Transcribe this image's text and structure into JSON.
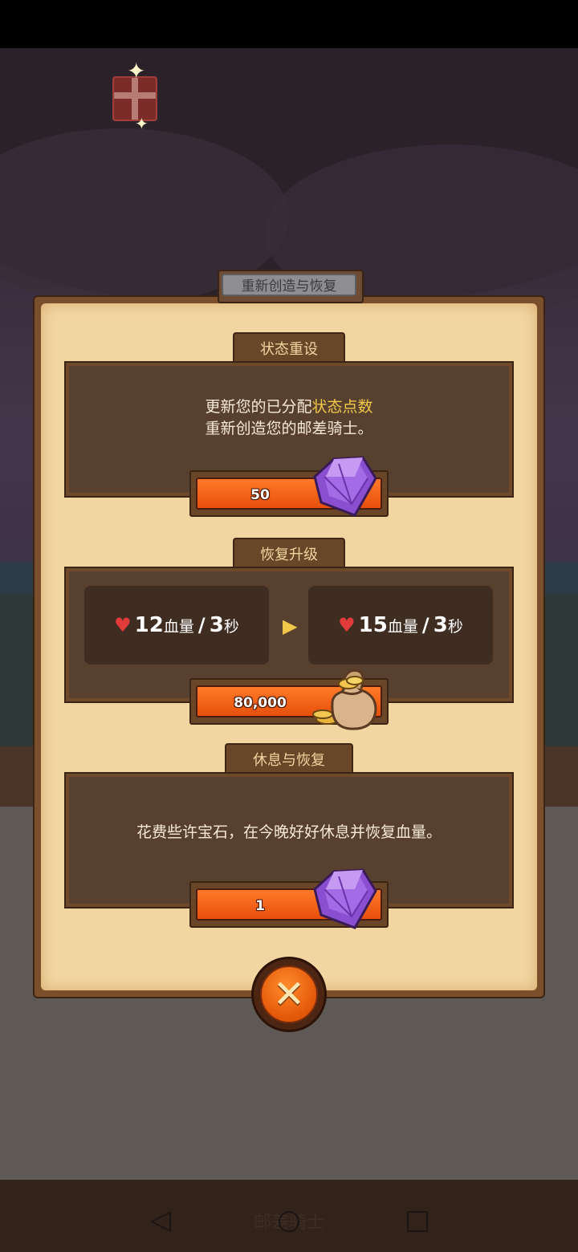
{
  "dialog": {
    "title": "重新创造与恢复"
  },
  "sections": {
    "reset": {
      "tab": "状态重设",
      "line1_prefix": "更新您的已分配",
      "line1_highlight": "状态点数",
      "line2": "重新创造您的邮差骑士。",
      "cost": "50",
      "currency_icon": "purple-gem-icon"
    },
    "upgrade": {
      "tab": "恢复升级",
      "current": {
        "value": "12",
        "unit": "血量",
        "sep": "/",
        "time": "3",
        "time_unit": "秒"
      },
      "next": {
        "value": "15",
        "unit": "血量",
        "sep": "/",
        "time": "3",
        "time_unit": "秒"
      },
      "cost": "80,000",
      "currency_icon": "gold-bag-icon"
    },
    "rest": {
      "tab": "休息与恢复",
      "text": "花费些许宝石，在今晚好好休息并恢复血量。",
      "cost": "1",
      "currency_icon": "purple-gem-icon"
    }
  },
  "background": {
    "dim_title": "邮差骑士"
  },
  "colors": {
    "accent": "#f0c84a",
    "button": "#e64f0b",
    "heart": "#e33a3a",
    "gem": "#8a4fd0"
  }
}
